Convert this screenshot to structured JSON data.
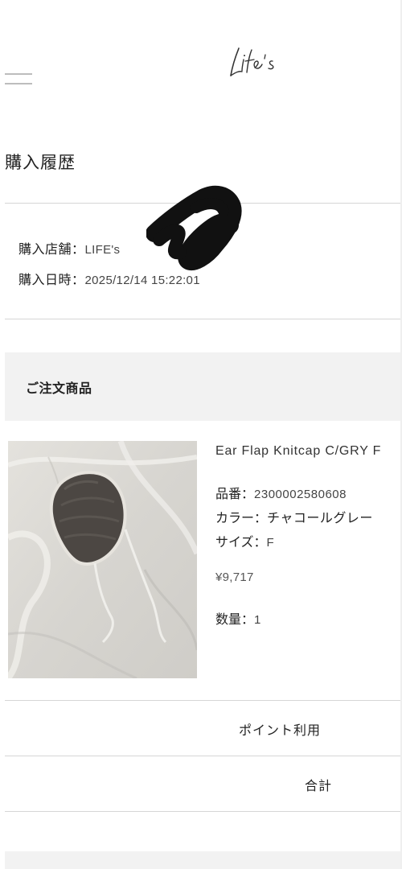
{
  "header": {
    "logo_text": "Life's",
    "menu_icon": "hamburger-menu-icon"
  },
  "page": {
    "title": "購入履歴"
  },
  "purchase_info": {
    "store_label": "購入店舗：",
    "store_value": "LIFE's",
    "date_label": "購入日時：",
    "date_value": "2025/12/14 15:22:01"
  },
  "order_section": {
    "title": "ご注文商品"
  },
  "product": {
    "name": "Ear Flap Knitcap C/GRY F",
    "sku_label": "品番：",
    "sku_value": "2300002580608",
    "color_label": "カラー：",
    "color_value": "チャコールグレー",
    "size_label": "サイズ：",
    "size_value": "F",
    "price": "¥9,717",
    "qty_label": "数量：",
    "qty_value": "1",
    "image_icon": "knit-cap-photo"
  },
  "summary": {
    "points_label": "ポイント利用",
    "total_label": "合計"
  },
  "colors": {
    "background": "#ffffff",
    "divider": "#d6d6d6",
    "band": "#f2f2f2",
    "text": "#222222"
  }
}
